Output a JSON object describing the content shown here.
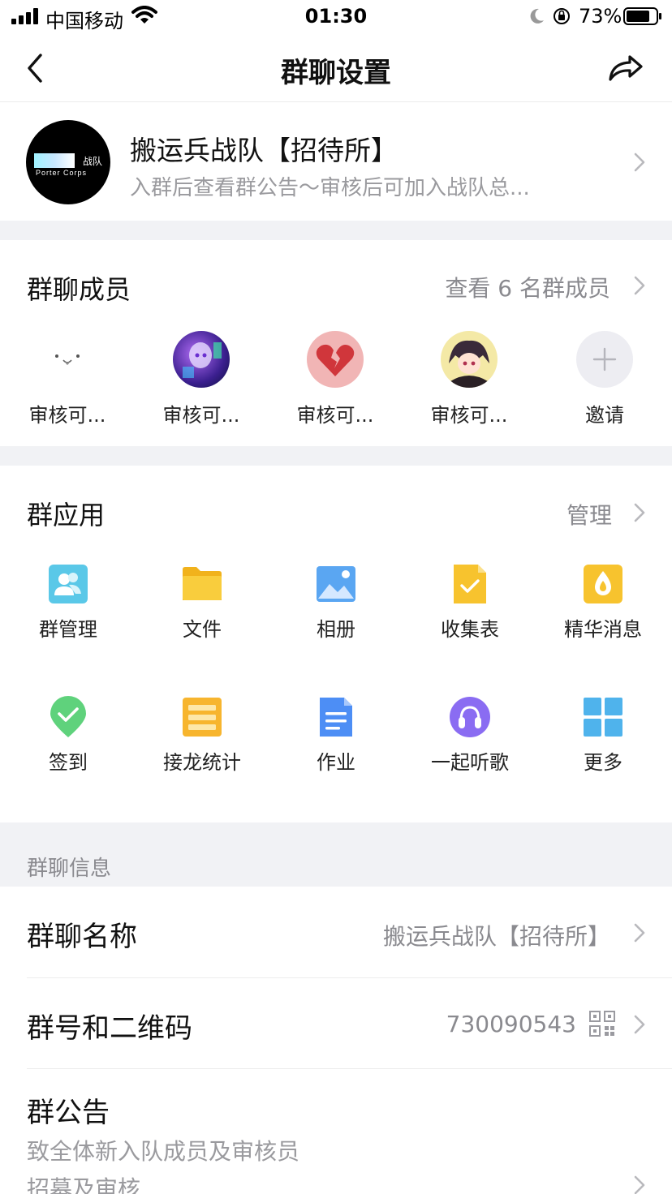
{
  "status_bar": {
    "carrier": "中国移动",
    "time": "01:30",
    "battery_pct": "73%"
  },
  "nav": {
    "title": "群聊设置",
    "back_icon": "chevron-left-icon",
    "share_icon": "share-icon"
  },
  "group": {
    "name": "搬运兵战队【招待所】",
    "desc": "入群后查看群公告～审核后可加入战队总..."
  },
  "members": {
    "title": "群聊成员",
    "view_all": "查看 6 名群成员",
    "items": [
      {
        "name": "审核可..."
      },
      {
        "name": "审核可..."
      },
      {
        "name": "审核可..."
      },
      {
        "name": "审核可..."
      }
    ],
    "invite_label": "邀请"
  },
  "apps": {
    "title": "群应用",
    "manage": "管理",
    "items": [
      {
        "label": "群管理",
        "icon": "group-manage-icon",
        "color": "#5ac8e8"
      },
      {
        "label": "文件",
        "icon": "folder-icon",
        "color": "#f7c32e"
      },
      {
        "label": "相册",
        "icon": "photo-album-icon",
        "color": "#5aa6f2"
      },
      {
        "label": "收集表",
        "icon": "form-icon",
        "color": "#f7c32e"
      },
      {
        "label": "精华消息",
        "icon": "essence-icon",
        "color": "#f7c32e"
      },
      {
        "label": "签到",
        "icon": "check-in-icon",
        "color": "#5fd27c"
      },
      {
        "label": "接龙统计",
        "icon": "relay-list-icon",
        "color": "#f7b52e"
      },
      {
        "label": "作业",
        "icon": "homework-icon",
        "color": "#4d8ef5"
      },
      {
        "label": "一起听歌",
        "icon": "headphones-icon",
        "color": "#8a6cf2"
      },
      {
        "label": "更多",
        "icon": "grid-more-icon",
        "color": "#4fb3ec"
      }
    ]
  },
  "info": {
    "section_label": "群聊信息",
    "name_row": {
      "title": "群聊名称",
      "value": "搬运兵战队【招待所】"
    },
    "id_row": {
      "title": "群号和二维码",
      "value": "730090543"
    },
    "announcement": {
      "title": "群公告",
      "line1": "致全体新入队成员及审核员",
      "line2": "招募及审核"
    }
  }
}
